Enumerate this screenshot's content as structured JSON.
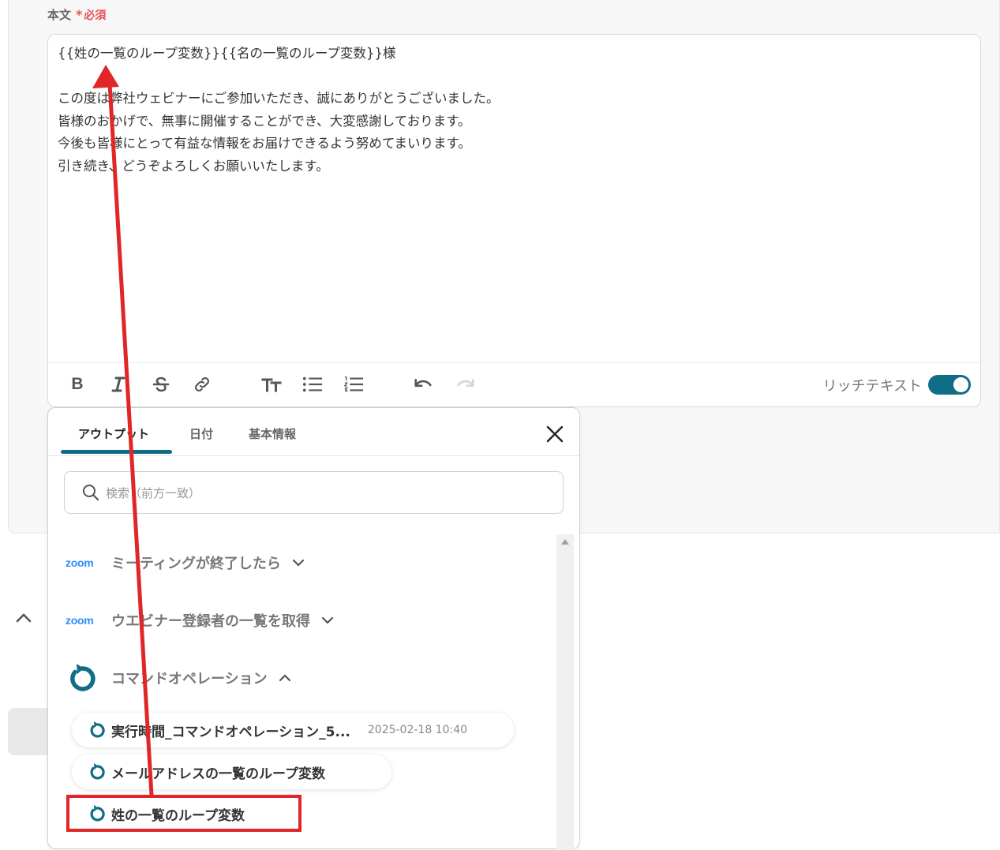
{
  "field": {
    "label": "本文",
    "required_mark": "*",
    "required_text": "必須"
  },
  "editor": {
    "content": "{{姓の一覧のループ変数}}{{名の一覧のループ変数}}様\n\nこの度は弊社ウェビナーにご参加いただき、誠にありがとうございました。\n皆様のおかげで、無事に開催することができ、大変感謝しております。\n今後も皆様にとって有益な情報をお届けできるよう努めてまいります。\n引き続き、どうぞよろしくお願いいたします。",
    "toolbar": {
      "bold": "B",
      "rich_text_label": "リッチテキスト",
      "rich_text_enabled": true
    }
  },
  "popup": {
    "tabs": [
      {
        "label": "アウトプット",
        "active": true
      },
      {
        "label": "日付",
        "active": false
      },
      {
        "label": "基本情報",
        "active": false
      }
    ],
    "search_placeholder": "検索（前方一致）",
    "groups": [
      {
        "logo": "zoom",
        "label": "ミーティングが終了したら",
        "expanded": false
      },
      {
        "logo": "zoom",
        "label": "ウエビナー登録者の一覧を取得",
        "expanded": false
      },
      {
        "icon": "loop-icon",
        "label": "コマンドオペレーション",
        "expanded": true
      }
    ],
    "items": [
      {
        "label": "実行時間_コマンドオペレーション_5...",
        "timestamp": "2025-02-18 10:40"
      },
      {
        "label": "メールアドレスの一覧のループ変数"
      },
      {
        "label": "姓の一覧のループ変数",
        "highlighted": true
      }
    ]
  },
  "colors": {
    "accent": "#0f6d86",
    "required": "#e8505b",
    "zoom": "#2d8cff",
    "annotation": "#e02626"
  }
}
